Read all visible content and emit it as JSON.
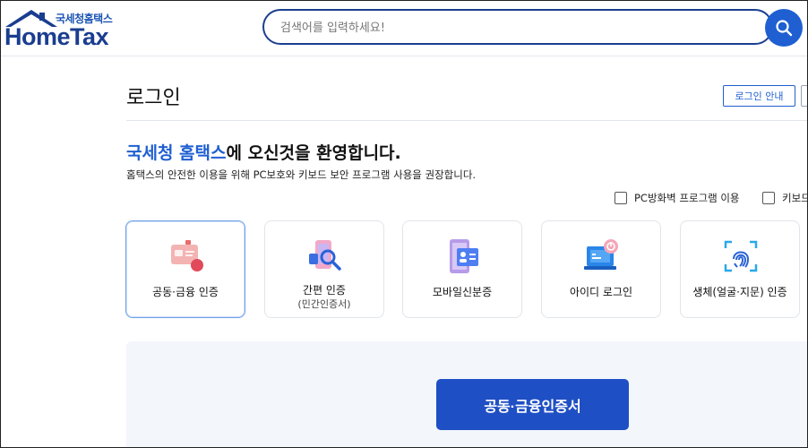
{
  "header": {
    "logo_sub": "국세청홈택스",
    "logo_main": "HomeTax",
    "search_placeholder": "검색어를 입력하세요!"
  },
  "page": {
    "title": "로그인",
    "guide_label": "로그인 안내"
  },
  "welcome": {
    "brand": "국세청 홈택스",
    "rest": "에 오신것을 환영합니다.",
    "desc": "홈택스의 안전한 이용을 위해 PC보호와 키보드 보안 프로그램 사용을 권장합니다."
  },
  "options": [
    {
      "label": "PC방화벽 프로그램 이용"
    },
    {
      "label": "키보드"
    }
  ],
  "methods": [
    {
      "label": "공동·금융 인증",
      "sub": "",
      "icon": "certificate-card-icon"
    },
    {
      "label": "간편 인증",
      "sub": "(민간인증서)",
      "icon": "simple-auth-phone-icon"
    },
    {
      "label": "모바일신분증",
      "sub": "",
      "icon": "mobile-id-icon"
    },
    {
      "label": "아이디 로그인",
      "sub": "",
      "icon": "id-login-laptop-icon"
    },
    {
      "label": "생체(얼굴·지문) 인증",
      "sub": "",
      "icon": "fingerprint-icon"
    }
  ],
  "primary_button": "공동·금융인증서",
  "colors": {
    "brand_blue": "#1f5fd1",
    "navy": "#1a3d8f",
    "button_blue": "#1f4fc4"
  }
}
